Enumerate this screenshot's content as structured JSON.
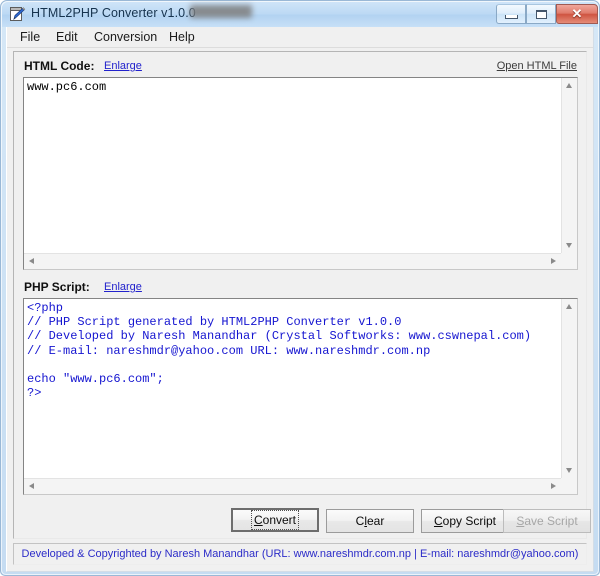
{
  "window": {
    "title": "HTML2PHP Converter v1.0.0",
    "icon": "document-pen-icon",
    "controls": {
      "minimize_label": "Minimize",
      "maximize_label": "Maximize",
      "close_label": "✕"
    }
  },
  "menubar": {
    "items": [
      {
        "label": "File"
      },
      {
        "label": "Edit"
      },
      {
        "label": "Conversion"
      },
      {
        "label": "Help"
      }
    ]
  },
  "html_section": {
    "label": "HTML Code:",
    "enlarge_label": "Enlarge",
    "open_file_label": "Open HTML File",
    "content": "www.pc6.com"
  },
  "php_section": {
    "label": "PHP Script:",
    "enlarge_label": "Enlarge",
    "content": "<?php\n// PHP Script generated by HTML2PHP Converter v1.0.0\n// Developed by Naresh Manandhar (Crystal Softworks: www.cswnepal.com)\n// E-mail: nareshmdr@yahoo.com URL: www.nareshmdr.com.np\n\necho \"www.pc6.com\";\n?>"
  },
  "buttons": {
    "convert": {
      "pre": "",
      "accel": "C",
      "post": "onvert"
    },
    "clear": {
      "pre": "C",
      "accel": "l",
      "post": "ear"
    },
    "copy_script": {
      "pre": "",
      "accel": "C",
      "post": "opy Script"
    },
    "save_script": {
      "pre": "",
      "accel": "S",
      "post": "ave Script"
    }
  },
  "statusbar": {
    "text": "Developed & Copyrighted by Naresh Manandhar (URL: www.nareshmdr.com.np  |  E-mail: nareshmdr@yahoo.com)"
  },
  "colors": {
    "title_text": "#16334e",
    "link_blue": "#2222cc",
    "php_text": "#1515d0",
    "status_text": "#2c2cc8",
    "close_btn": "#cf5441"
  }
}
